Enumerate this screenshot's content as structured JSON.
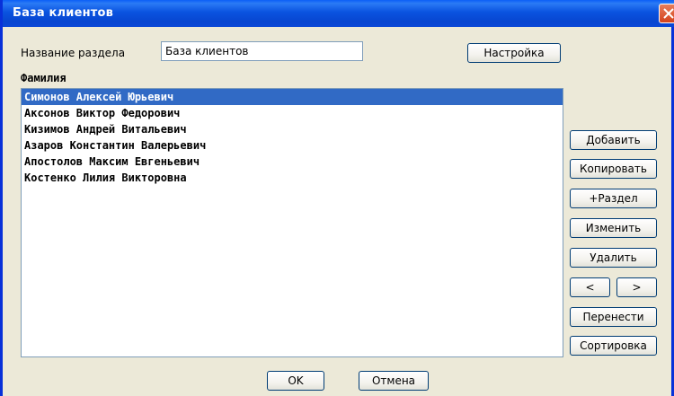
{
  "window": {
    "title": "База клиентов"
  },
  "section": {
    "label": "Название раздела",
    "value": "База клиентов",
    "settings_button": "Настройка"
  },
  "list": {
    "header": "Фамилия",
    "items": [
      "Симонов Алексей Юрьевич",
      "Аксонов Виктор Федорович",
      "Кизимов Андрей Витальевич",
      "Азаров Константин Валерьевич",
      "Апостолов Максим Евгеньевич",
      "Костенко Лилия Викторовна"
    ],
    "selected_index": 0
  },
  "actions": {
    "add": "Добавить",
    "copy": "Копировать",
    "add_section": "+Раздел",
    "edit": "Изменить",
    "delete": "Удалить",
    "prev": "<",
    "next": ">",
    "move": "Перенести",
    "sort": "Сортировка"
  },
  "footer": {
    "ok": "OK",
    "cancel": "Отмена"
  },
  "colors": {
    "selection": "#316ac5",
    "titlebar": "#0a53e0",
    "dialog_bg": "#ece9d8"
  }
}
